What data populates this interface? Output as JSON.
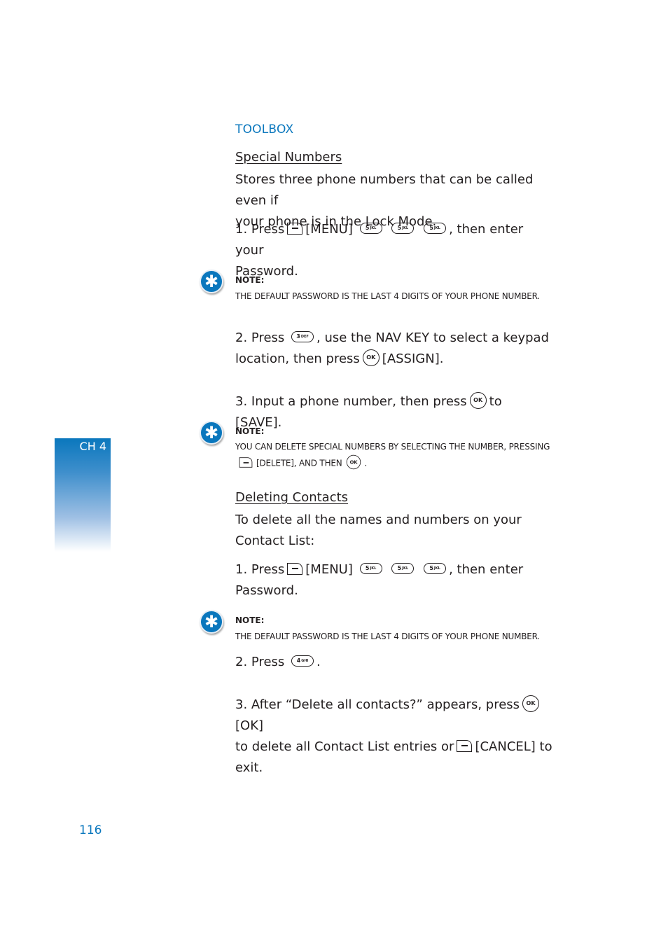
{
  "section_title": "TOOLBOX",
  "chapter_tab": "CH 4",
  "page_number": "116",
  "special_numbers": {
    "heading": "Special Numbers",
    "description_line1": "Stores three phone numbers that can be called even if",
    "description_line2": "your phone is in the Lock Mode.",
    "step1": {
      "prefix": "1. Press",
      "menu": "[MENU]",
      "suffix": ", then enter your",
      "line2": "Password."
    },
    "note1": {
      "title": "NOTE:",
      "text": "THE DEFAULT PASSWORD IS THE LAST 4 DIGITS OF YOUR PHONE NUMBER."
    },
    "step2": {
      "prefix": "2. Press",
      "suffix": ", use the NAV KEY to select a keypad",
      "line2_prefix": "location, then press",
      "line2_suffix": "[ASSIGN]."
    },
    "step3": {
      "prefix": "3. Input a phone number, then press",
      "suffix": "to [SAVE]."
    },
    "note2": {
      "title": "NOTE:",
      "text": "YOU CAN DELETE SPECIAL NUMBERS BY SELECTING THE NUMBER, PRESSING",
      "line2_mid": "[DELETE], AND THEN",
      "line2_end": "."
    }
  },
  "deleting_contacts": {
    "heading": "Deleting Contacts",
    "description_line1": "To delete all the names and numbers on your",
    "description_line2": "Contact List:",
    "step1": {
      "prefix": "1. Press",
      "menu": "[MENU]",
      "suffix": ", then enter",
      "line2": "Password."
    },
    "note": {
      "title": "NOTE:",
      "text": "THE DEFAULT PASSWORD IS THE LAST 4 DIGITS OF YOUR PHONE NUMBER."
    },
    "step2": {
      "prefix": "2. Press",
      "suffix": "."
    },
    "step3": {
      "prefix": "3. After “Delete all contacts?” appears, press",
      "ok_label": "[OK]",
      "line2_prefix": "to delete all Contact List entries or",
      "line2_suffix": "[CANCEL] to exit."
    }
  },
  "keys": {
    "key5": {
      "num": "5",
      "letters": "JKL"
    },
    "key3": {
      "num": "3",
      "letters": "DEF"
    },
    "key4": {
      "num": "4",
      "letters": "GHI"
    },
    "ok": "OK",
    "note_icon": "✱"
  }
}
